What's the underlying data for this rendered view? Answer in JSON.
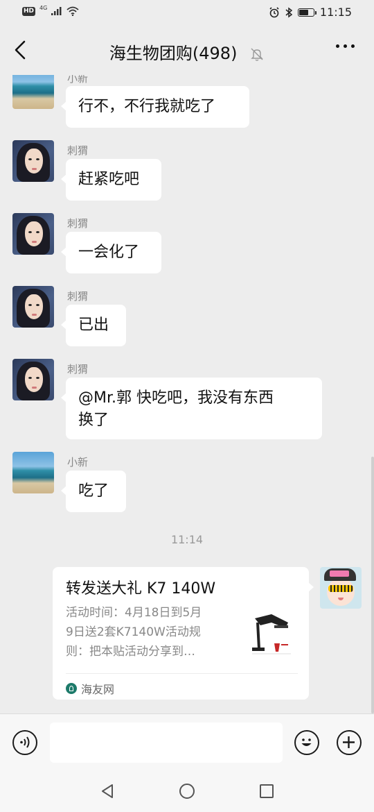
{
  "status_bar": {
    "hd": "HD",
    "network": "4G",
    "time": "11:15",
    "battery_level": 0.7
  },
  "header": {
    "title": "海生物团购(498)",
    "back_icon": "chevron-left-icon",
    "mute_icon": "bell-muted-icon",
    "more_icon": "more-dots-icon"
  },
  "messages": [
    {
      "sender": "小新",
      "text": "行不，不行我就吃了",
      "avatar": "beach"
    },
    {
      "sender": "刺猬",
      "text": "赶紧吃吧",
      "avatar": "girl"
    },
    {
      "sender": "刺猬",
      "text": "一会化了",
      "avatar": "girl"
    },
    {
      "sender": "刺猬",
      "text": "已出",
      "avatar": "girl"
    },
    {
      "sender": "刺猬",
      "text_line1": "@Mr.郭  快吃吧，我没有东西",
      "text_line2": "换了",
      "avatar": "girl"
    },
    {
      "sender": "小新",
      "text": "吃了",
      "avatar": "beach"
    }
  ],
  "time_separator": "11:14",
  "link_card": {
    "title": "转发送大礼 K7 140W",
    "desc_line1": "活动时间：4月18日到5月",
    "desc_line2": "9日送2套K7140W活动规",
    "desc_line3": "则：把本贴活动分享到…",
    "source": "海友网"
  },
  "input_bar": {
    "voice_icon": "voice-icon",
    "emoji_icon": "emoji-icon",
    "plus_icon": "plus-icon",
    "input_value": ""
  },
  "colors": {
    "background": "#ededed",
    "bubble": "#ffffff",
    "meta_text": "#888888"
  }
}
